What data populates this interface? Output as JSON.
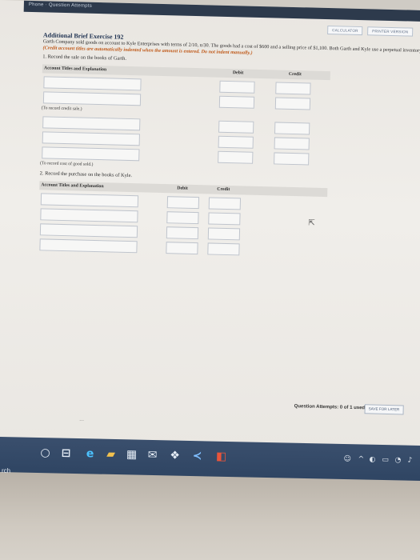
{
  "browser": {
    "tab_text": "Phone · Question Attempts"
  },
  "toolbar": {
    "calculator": "CALCULATOR",
    "printer": "PRINTER VERSION"
  },
  "exercise": {
    "title": "Additional Brief Exercise 192",
    "line1": "Garth Company sold goods on account to Kyle Enterprises with terms of 2/10, n/30. The goods had a cost of $600 and a selling price of $1,100. Both Garth and Kyle use a perpetual inventory syste",
    "instruction": "(Credit account titles are automatically indented when the amount is entered. Do not indent manually.)",
    "q1": "1. Record the sale on the books of Garth.",
    "q2": "2. Record the purchase on the books of Kyle."
  },
  "table": {
    "col_account": "Account Titles and Explanation",
    "col_debit": "Debit",
    "col_credit": "Credit"
  },
  "notes": {
    "credit_sale": "(To record credit sale.)",
    "cost_goods": "(To record cost of good sold.)"
  },
  "footer": {
    "attempts": "Question Attempts: 0 of 1 used",
    "save_later": "SAVE FOR LATER",
    "dots": "···"
  },
  "taskbar": {
    "search_label": "rch",
    "items": [
      "search-circle-icon",
      "task-view-icon",
      "edge-icon",
      "file-explorer-icon",
      "store-icon",
      "mail-icon",
      "dropbox-icon",
      "vscode-icon",
      "office-icon"
    ]
  }
}
